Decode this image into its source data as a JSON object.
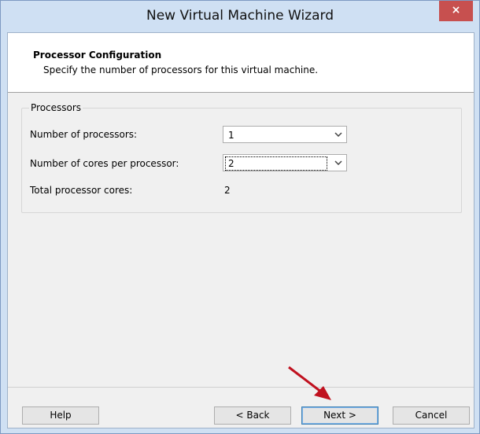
{
  "window": {
    "title": "New Virtual Machine Wizard",
    "close_symbol": "×"
  },
  "header": {
    "title": "Processor Configuration",
    "subtitle": "Specify the number of processors for this virtual machine."
  },
  "processors": {
    "group_label": "Processors",
    "num_processors_label": "Number of processors:",
    "num_processors_value": "1",
    "cores_per_processor_label": "Number of cores per processor:",
    "cores_per_processor_value": "2",
    "total_cores_label": "Total processor cores:",
    "total_cores_value": "2",
    "dropdown_arrow": "⌄"
  },
  "buttons": {
    "help": "Help",
    "back": "< Back",
    "next": "Next >",
    "cancel": "Cancel"
  },
  "colors": {
    "frame": "#cfe0f3",
    "close": "#c7504f",
    "annotation_arrow": "#c0111f"
  },
  "icons": {
    "close": "close-icon",
    "dropdown": "chevron-down-icon",
    "annotation": "red-arrow-icon"
  }
}
